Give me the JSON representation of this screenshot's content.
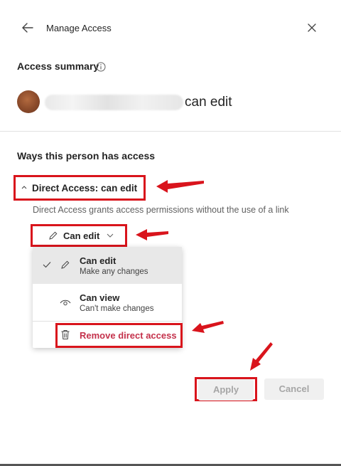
{
  "header": {
    "title": "Manage Access",
    "back_icon": "arrow-left-icon",
    "close_icon": "close-icon"
  },
  "summary": {
    "title": "Access summary",
    "info_icon": "info-icon",
    "permission_text": "can edit"
  },
  "ways": {
    "title": "Ways this person has access",
    "direct_title": "Direct Access: can edit",
    "direct_description": "Direct Access grants access permissions without the use of a link"
  },
  "permission_dropdown": {
    "label": "Can edit"
  },
  "menu": {
    "items": [
      {
        "title": "Can edit",
        "subtitle": "Make any changes",
        "icon": "pencil-icon",
        "selected": true
      },
      {
        "title": "Can view",
        "subtitle": "Can't make changes",
        "icon": "eye-icon",
        "selected": false
      }
    ],
    "remove_label": "Remove direct access"
  },
  "actions": {
    "apply": "Apply",
    "cancel": "Cancel"
  },
  "colors": {
    "accent_red_annotation": "#d9141c",
    "remove_text": "#c4314b",
    "disabled_bg": "#f0f0f0"
  }
}
